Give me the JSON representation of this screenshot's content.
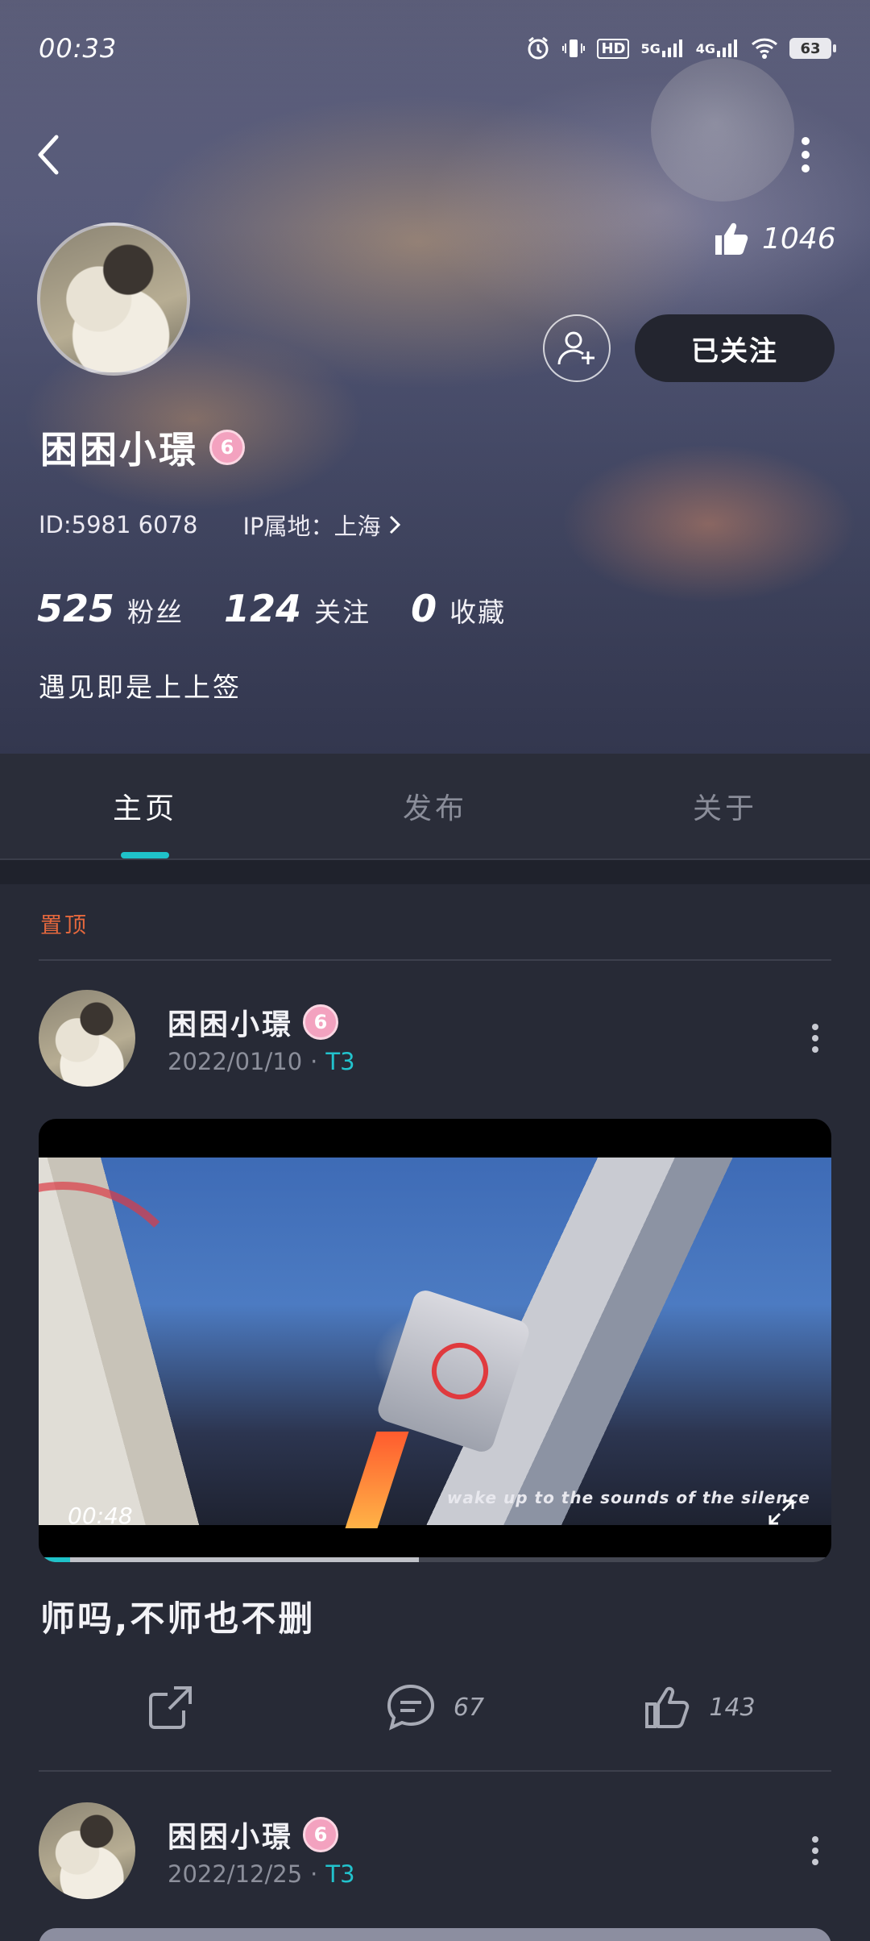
{
  "status_bar": {
    "time": "00:33",
    "hd_label": "HD",
    "network_5g": "5G",
    "network_4g": "4G",
    "battery": "63"
  },
  "profile": {
    "likes_total": "1046",
    "follow_status": "已关注",
    "username": "困困小璟",
    "level": "6",
    "user_id": "ID:5981 6078",
    "ip_location": "IP属地：上海",
    "stats": {
      "fans_count": "525",
      "fans_label": "粉丝",
      "following_count": "124",
      "following_label": "关注",
      "favorites_count": "0",
      "favorites_label": "收藏"
    },
    "bio": "遇见即是上上签"
  },
  "tabs": [
    {
      "label": "主页",
      "active": true
    },
    {
      "label": "发布",
      "active": false
    },
    {
      "label": "关于",
      "active": false
    }
  ],
  "feed": {
    "pinned_label": "置顶",
    "posts": [
      {
        "author": "困困小璟",
        "level": "6",
        "date": "2022/01/10",
        "separator": "·",
        "tag": "T3",
        "video": {
          "duration": "00:48",
          "caption": "wake up to the sounds of the silence",
          "progress": 0.48,
          "buffered": 0.04
        },
        "text": "师吗,不师也不删",
        "comments": "67",
        "likes": "143"
      },
      {
        "author": "困困小璟",
        "level": "6",
        "date": "2022/12/25",
        "separator": "·",
        "tag": "T3"
      }
    ]
  },
  "colors": {
    "accent": "#1fc2c9",
    "pinned": "#e5683d",
    "background": "#272a36",
    "badge": "#f3a2bf"
  }
}
